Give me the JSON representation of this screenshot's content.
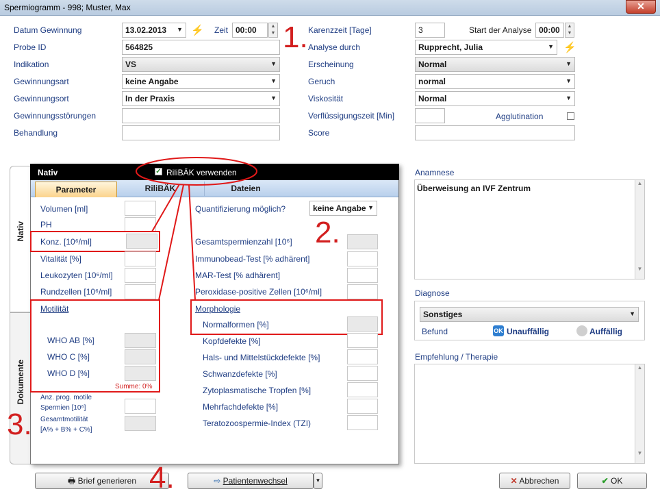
{
  "window": {
    "title": "Spermiogramm - 998; Muster, Max",
    "close_label": "✕"
  },
  "top_form": {
    "datum_gewinnung_label": "Datum Gewinnung",
    "datum_gewinnung_value": "13.02.2013",
    "zeit_label": "Zeit",
    "zeit_value": "00:00",
    "probe_id_label": "Probe ID",
    "probe_id_value": "564825",
    "indikation_label": "Indikation",
    "indikation_value": "VS",
    "gewinnungsart_label": "Gewinnungsart",
    "gewinnungsart_value": "keine Angabe",
    "gewinnungsort_label": "Gewinnungsort",
    "gewinnungsort_value": "In der Praxis",
    "gewinnungsstoerungen_label": "Gewinnungsstörungen",
    "behandlung_label": "Behandlung",
    "karenzzeit_label": "Karenzzeit [Tage]",
    "karenzzeit_value": "3",
    "start_analyse_label": "Start der Analyse",
    "start_analyse_value": "00:00",
    "analyse_durch_label": "Analyse durch",
    "analyse_durch_value": "Rupprecht, Julia",
    "erscheinung_label": "Erscheinung",
    "erscheinung_value": "Normal",
    "geruch_label": "Geruch",
    "geruch_value": "normal",
    "viskositaet_label": "Viskosität",
    "viskositaet_value": "Normal",
    "verfluessigungszeit_label": "Verflüssigungszeit [Min]",
    "agglutination_label": "Agglutination",
    "score_label": "Score"
  },
  "annotations": {
    "n1": "1.",
    "n2": "2.",
    "n3": "3.",
    "n4": "4."
  },
  "side_tabs": {
    "nativ": "Nativ",
    "dokumente": "Dokumente"
  },
  "nativ_panel": {
    "header": "Nativ",
    "rilibaek_checkbox_label": "RiliBÄK verwenden",
    "rilibaek_checked": true,
    "tabs": [
      "Parameter",
      "RiliBÄK",
      "Dateien"
    ],
    "active_tab": "Parameter",
    "left": {
      "volumen": "Volumen [ml]",
      "ph": "PH",
      "konz": "Konz. [10⁶/ml]",
      "vitalitaet": "Vitalität [%]",
      "leukozyten": "Leukozyten [10⁶/ml]",
      "rundzellen": "Rundzellen [10⁶/ml]",
      "motilitaet": "Motilität",
      "who_ab": "WHO AB [%]",
      "who_c": "WHO C [%]",
      "who_d": "WHO D [%]",
      "summe": "Summe: 0%",
      "anz_prog_1": "Anz. prog. motile",
      "anz_prog_2": "Spermien [10⁶]",
      "gesamt_1": "Gesamtmotilität",
      "gesamt_2": "[A% + B% + C%]"
    },
    "right": {
      "quantifizierung_label": "Quantifizierung möglich?",
      "quantifizierung_value": "keine Angabe",
      "gesamtspermienzahl": "Gesamtspermienzahl [10⁶]",
      "immunobead": "Immunobead-Test [% adhärent]",
      "mar": "MAR-Test [% adhärent]",
      "peroxidase": "Peroxidase-positive Zellen [10⁶/ml]",
      "morphologie": "Morphologie",
      "normalformen": "Normalformen [%]",
      "kopfdefekte": "Kopfdefekte [%]",
      "hals": "Hals- und Mittelstückdefekte [%]",
      "schwanz": "Schwanzdefekte [%]",
      "zytoplasmatische": "Zytoplasmatische Tropfen [%]",
      "mehrfach": "Mehrfachdefekte [%]",
      "tzi": "Teratozoospermie-Index (TZI)"
    }
  },
  "anamnese": {
    "label": "Anamnese",
    "text": "Überweisung an IVF Zentrum"
  },
  "diagnose": {
    "label": "Diagnose",
    "value": "Sonstiges",
    "befund_label": "Befund",
    "unauffaellig": "Unauffällig",
    "auffaellig": "Auffällig",
    "ok_badge": "OK",
    "selected": "Unauffällig"
  },
  "empfehlung": {
    "label": "Empfehlung / Therapie"
  },
  "buttons": {
    "brief": "Brief generieren",
    "patientenwechsel": "Patientenwechsel",
    "abbrechen": "Abbrechen",
    "ok": "OK"
  }
}
